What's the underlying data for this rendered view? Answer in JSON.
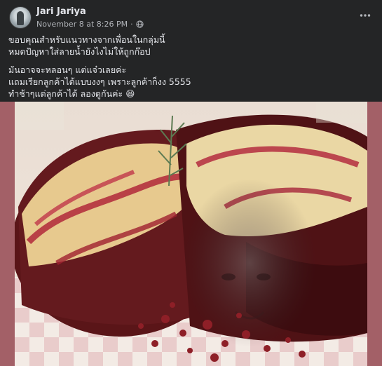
{
  "post": {
    "author": "Jari Jariya",
    "timestamp": "November 8 at 8:26 PM",
    "separator": "·",
    "audience_icon": "globe-icon",
    "more_icon": "more-horizontal-icon",
    "paragraphs": [
      {
        "lines": [
          "ขอบคุณสำหรับแนวทางจากเพื่อนในกลุ่มนี้",
          "หมดปัญหาใส่ลายน้ำยังไงไม่ให้ถูกก๊อป"
        ]
      },
      {
        "lines": [
          "มันอาจจะหลอนๆ แต่แจ๋วเลยค่ะ",
          "แถมเรียกลูกค้าได้แบบงงๆ เพราะลูกค้าก็งง 5555",
          "ทำช้าๆแต่ลูกค้าได้ ลองดูกันค่ะ 😆"
        ]
      }
    ],
    "photo": {
      "subject": "red-velvet-cheesecake-brownie-with-face-watermark"
    }
  },
  "colors": {
    "background": "#242526",
    "text_primary": "#e4e6eb",
    "text_secondary": "#b0b3b8",
    "photo_border": "#a36067"
  }
}
